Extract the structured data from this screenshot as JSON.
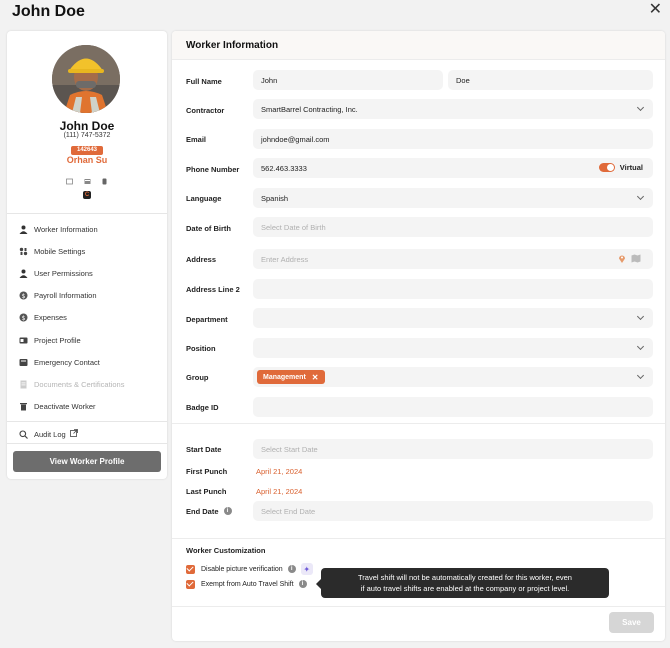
{
  "page": {
    "title": "John Doe"
  },
  "profile": {
    "name": "John Doe",
    "phone": "(111) 747-5372",
    "badge": "142643",
    "subtitle": "Orhan Su"
  },
  "sidebar": {
    "items": [
      {
        "label": "Worker Information",
        "icon": "person-icon"
      },
      {
        "label": "Mobile Settings",
        "icon": "mobile-settings-icon"
      },
      {
        "label": "User Permissions",
        "icon": "user-permissions-icon"
      },
      {
        "label": "Payroll Information",
        "icon": "dollar-icon"
      },
      {
        "label": "Expenses",
        "icon": "dollar-icon"
      },
      {
        "label": "Project Profile",
        "icon": "project-icon"
      },
      {
        "label": "Emergency Contact",
        "icon": "phone-icon"
      },
      {
        "label": "Documents & Certifications",
        "icon": "document-icon",
        "disabled": true
      },
      {
        "label": "Deactivate Worker",
        "icon": "trash-icon"
      }
    ],
    "audit_log": "Audit Log",
    "view_profile": "View Worker Profile"
  },
  "form": {
    "title": "Worker Information",
    "labels": {
      "full_name": "Full Name",
      "contractor": "Contractor",
      "email": "Email",
      "phone": "Phone Number",
      "language": "Language",
      "dob": "Date of Birth",
      "address": "Address",
      "address2": "Address Line 2",
      "department": "Department",
      "position": "Position",
      "group": "Group",
      "badge_id": "Badge ID",
      "start_date": "Start Date",
      "first_punch": "First Punch",
      "last_punch": "Last Punch",
      "end_date": "End Date"
    },
    "values": {
      "first_name": "John",
      "last_name": "Doe",
      "contractor": "SmartBarrel Contracting, Inc.",
      "email": "johndoe@gmail.com",
      "phone": "562.463.3333",
      "virtual_label": "Virtual",
      "virtual_on": true,
      "language": "Spanish",
      "group_chip": "Management",
      "first_punch": "April 21, 2024",
      "last_punch": "April 21, 2024"
    },
    "placeholders": {
      "dob": "Select Date of Birth",
      "address": "Enter Address",
      "start_date": "Select Start Date",
      "end_date": "Select End Date"
    }
  },
  "customization": {
    "title": "Worker Customization",
    "disable_picture": "Disable picture verification",
    "exempt_travel": "Exempt from Auto Travel Shift",
    "tooltip_line1": "Travel shift will not be automatically created for this worker, even",
    "tooltip_line2": "if auto travel shifts are enabled at the company or project level."
  },
  "actions": {
    "save": "Save"
  },
  "colors": {
    "accent": "#e06a3a",
    "tooltip_bg": "#2b2b2b",
    "button_gray": "#6d6d6d"
  }
}
